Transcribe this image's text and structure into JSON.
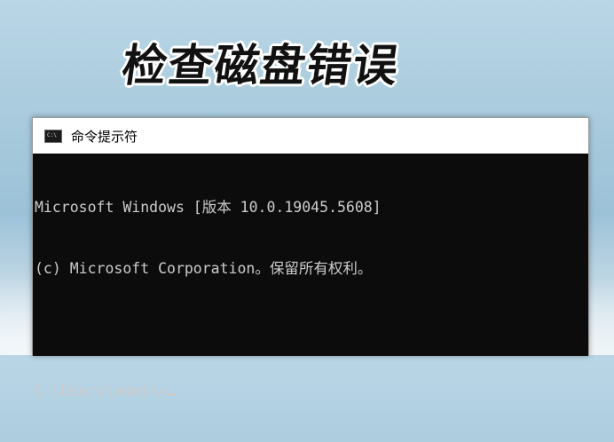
{
  "banner": {
    "title": "检查磁盘错误"
  },
  "window": {
    "title": "命令提示符",
    "icon": "cmd-icon",
    "icon_label": "C:\\",
    "lines": [
      "Microsoft Windows [版本 10.0.19045.5608]",
      "(c) Microsoft Corporation。保留所有权利。"
    ],
    "prompt": "C:\\Users\\admin>"
  },
  "colors": {
    "console_bg": "#0c0c0c",
    "console_text": "#cccccc",
    "titlebar_bg": "#ffffff"
  }
}
